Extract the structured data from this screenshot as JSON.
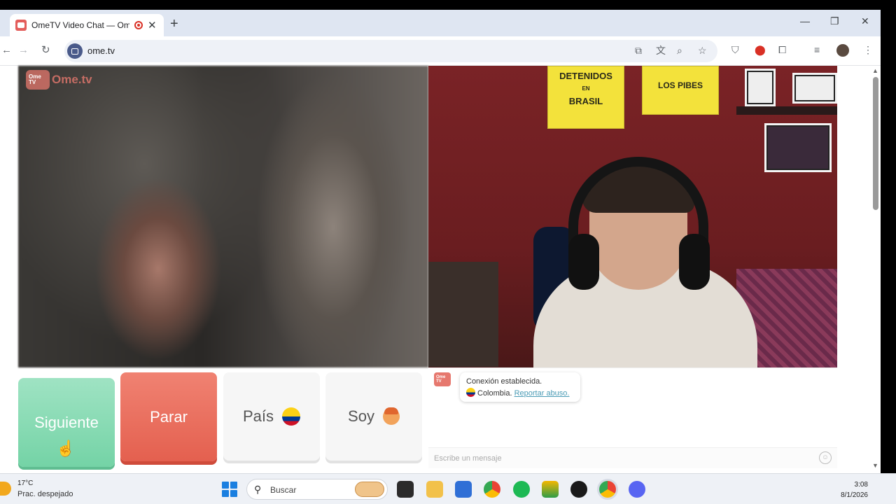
{
  "browser": {
    "tab_title": "OmeTV Video Chat — OmeTV",
    "tab_close": "✕",
    "new_tab": "+",
    "window_controls": {
      "minimize": "—",
      "maximize": "❐",
      "close": "✕"
    },
    "url": "ome.tv",
    "nav": {
      "back": "←",
      "forward": "→",
      "reload": "↻"
    }
  },
  "page": {
    "logo_text": "Ome.tv",
    "logo_tv": "Ome TV",
    "buttons": {
      "next": "Siguiente",
      "stop": "Parar",
      "country": "País",
      "gender": "Soy"
    },
    "chat": {
      "connection": "Conexión establecida.",
      "country": "Colombia.",
      "report": "Reportar abuso.",
      "placeholder": "Escribe un mensaje"
    },
    "posters": {
      "p1_line1": "DETENIDOS",
      "p1_line2": "EN",
      "p1_line3": "BRASIL",
      "p2_line1": "LOS PIBES"
    }
  },
  "taskbar": {
    "temperature": "17°C",
    "weather": "Prac. despejado",
    "search_label": "Buscar",
    "time": "3:08",
    "date": "8/1/2026"
  },
  "colors": {
    "next_button": "#74d3a6",
    "stop_button": "#e4604f",
    "brand": "#e6786e",
    "link": "#4a9bb5"
  }
}
